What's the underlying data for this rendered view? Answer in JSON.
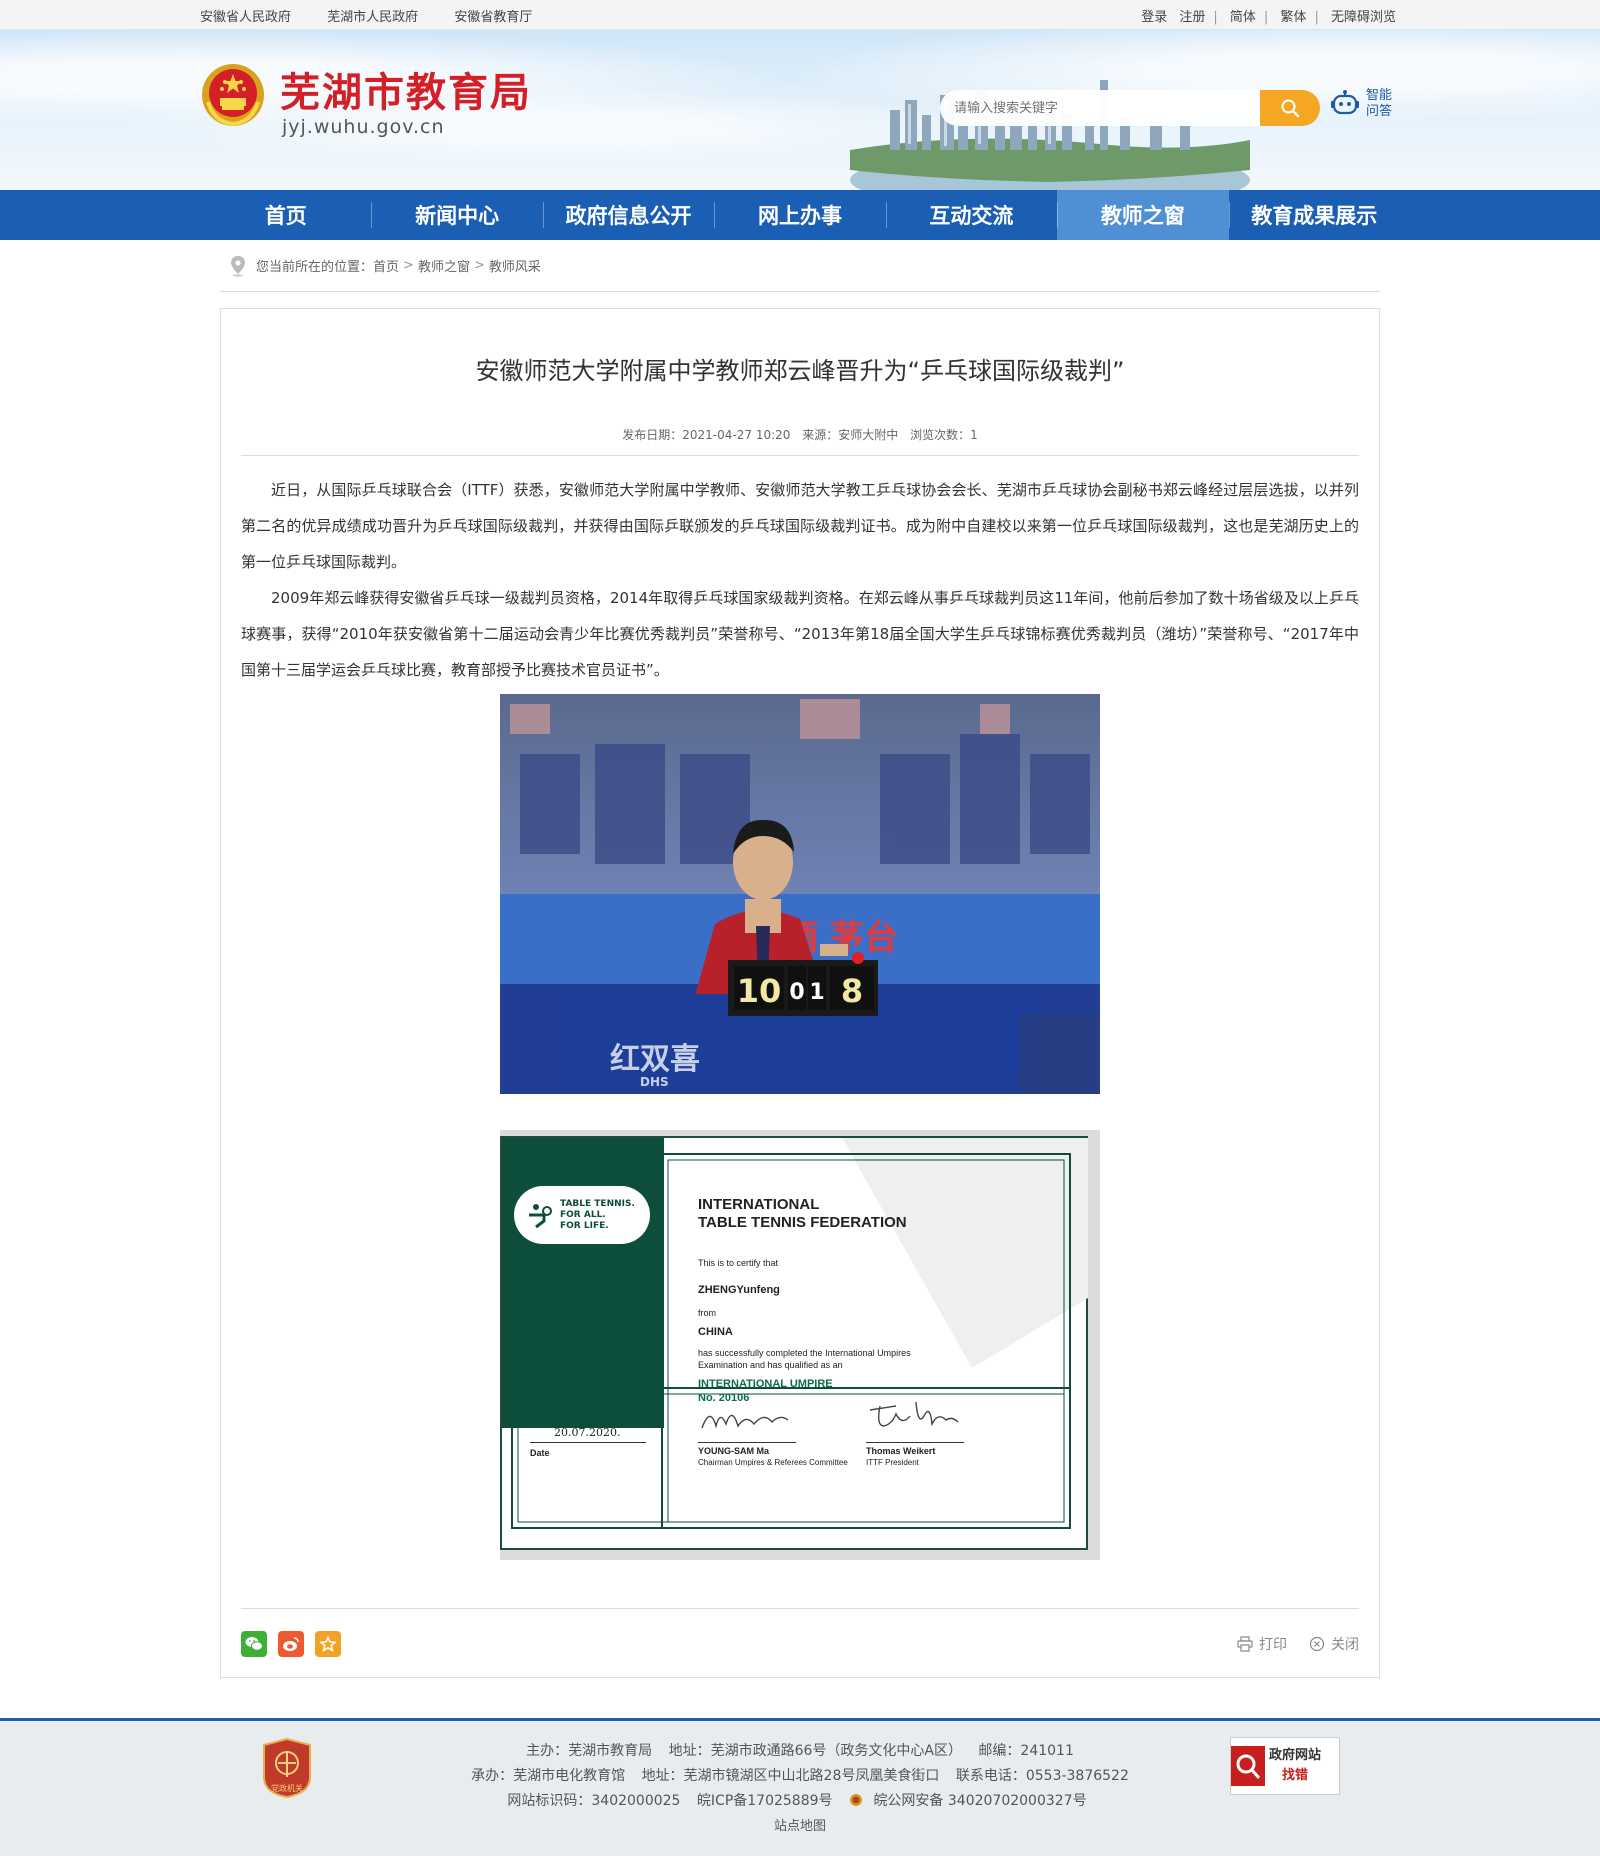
{
  "topbar": {
    "links": [
      "安徽省人民政府",
      "芜湖市人民政府",
      "安徽省教育厅"
    ],
    "right": [
      "登录",
      "注册",
      "简体",
      "繁体",
      "无障碍浏览"
    ]
  },
  "header": {
    "title": "芜湖市教育局",
    "domain": "jyj.wuhu.gov.cn",
    "search_placeholder": "请输入搜索关键字",
    "assistant_line1": "智能",
    "assistant_line2": "问答"
  },
  "nav": {
    "items": [
      "首页",
      "新闻中心",
      "政府信息公开",
      "网上办事",
      "互动交流",
      "教师之窗",
      "教育成果展示"
    ],
    "active_index": 5
  },
  "breadcrumb": {
    "prefix": "您当前所在的位置：",
    "items": [
      "首页",
      "教师之窗",
      "教师风采"
    ]
  },
  "article": {
    "title": "安徽师范大学附属中学教师郑云峰晋升为“乒乓球国际级裁判”",
    "publish": "发布日期：2021-04-27 10:20",
    "source": "来源：安师大附中",
    "views": "浏览次数：1",
    "paragraphs": [
      "近日，从国际乒乓球联合会（ITTF）获悉，安徽师范大学附属中学教师、安徽师范大学教工乒乓球协会会长、芜湖市乒乓球协会副秘书郑云峰经过层层选拔，以并列第二名的优异成绩成功晋升为乒乓球国际级裁判，并获得由国际乒联颁发的乒乓球国际级裁判证书。成为附中自建校以来第一位乒乓球国际级裁判，这也是芜湖历史上的第一位乒乓球国际裁判。",
      "2009年郑云峰获得安徽省乒乓球一级裁判员资格，2014年取得乒乓球国家级裁判资格。在郑云峰从事乒乓球裁判员这11年间，他前后参加了数十场省级及以上乒乓球赛事，获得“2010年获安徽省第十二届运动会青少年比赛优秀裁判员”荣誉称号、“2013年第18届全国大学生乒乓球锦标赛优秀裁判员（潍坊）”荣誉称号、“2017年中国第十三届学运会乒乓球比赛，教育部授予比赛技术官员证书”。"
    ],
    "photo": {
      "scoreboard": [
        "10",
        "0",
        "1",
        "8"
      ],
      "banner_text": "国酒 茅台",
      "brand_text": "红双喜",
      "brand_sub": "DHS"
    },
    "certificate": {
      "logo_text": [
        "TABLE TENNIS.",
        "FOR ALL.",
        "FOR LIFE."
      ],
      "org_line1": "INTERNATIONAL",
      "org_line2": "TABLE TENNIS FEDERATION",
      "certify": "This is to certify that",
      "name": "ZHENGYunfeng",
      "from": "from",
      "country": "CHINA",
      "desc1": "has successfully completed the International Umpires",
      "desc2": "Examination and has qualified as an",
      "title": "INTERNATIONAL UMPIRE",
      "number": "No. 20106",
      "date_value": "20.07.2020.",
      "date_label": "Date",
      "signer1": "YOUNG-SAM  Ma",
      "signer1_role": "Chairman Umpires & Referees Committee",
      "signer2": "Thomas Weikert",
      "signer2_role": "ITTF President"
    }
  },
  "tools": {
    "print": "打印",
    "close": "关闭"
  },
  "footer": {
    "line1": [
      "主办：芜湖市教育局",
      "地址：芜湖市政通路66号（政务文化中心A区）",
      "邮编：241011"
    ],
    "line2": [
      "承办：芜湖市电化教育馆",
      "地址：芜湖市镜湖区中山北路28号凤凰美食街口",
      "联系电话：0553-3876522"
    ],
    "line3": [
      "网站标识码：3402000025",
      "皖ICP备17025889号",
      "皖公网安备 34020702000327号"
    ],
    "sitemap": "站点地图",
    "badge_text": "党政机关",
    "find_line1": "政府网站",
    "find_line2": "找错"
  },
  "colors": {
    "nav_blue": "#1a5fb4",
    "title_red": "#d31f26",
    "search_orange": "#f5a623",
    "cert_green": "#0c4d3c"
  }
}
